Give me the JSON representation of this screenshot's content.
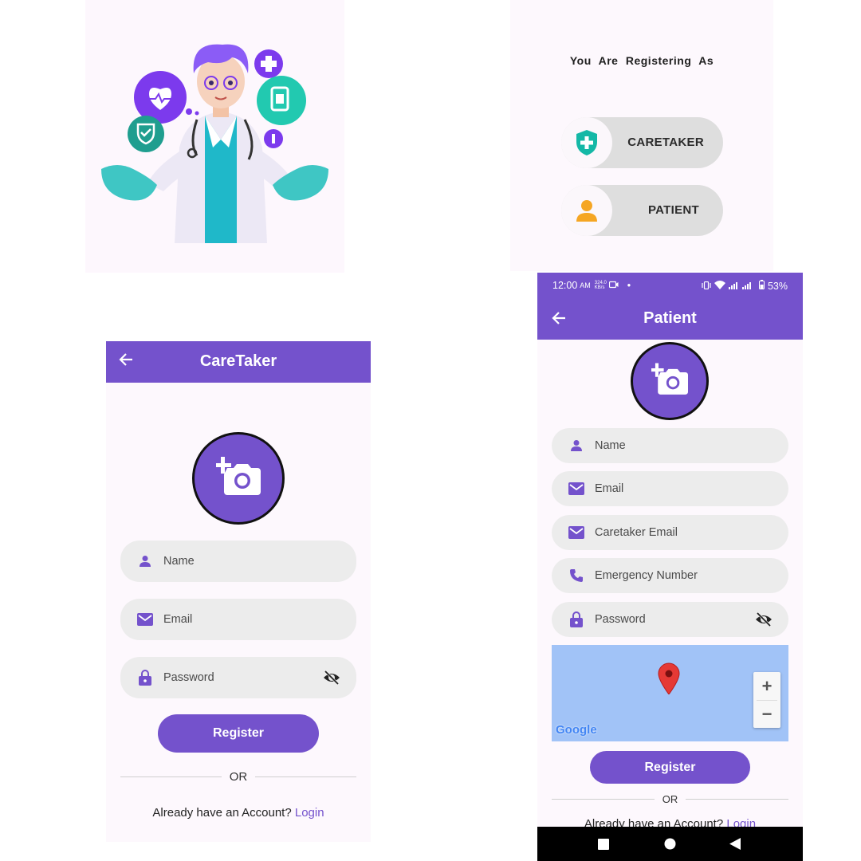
{
  "role_select": {
    "heading": "You  Are  Registering  As",
    "options": [
      {
        "label": "CARETAKER",
        "icon": "shield-plus-icon"
      },
      {
        "label": "PATIENT",
        "icon": "person-icon"
      }
    ]
  },
  "caretaker_screen": {
    "title": "CareTaker",
    "fields": {
      "name": "Name",
      "email": "Email",
      "password": "Password"
    },
    "register_label": "Register",
    "or_label": "OR",
    "login_prompt": "Already have an Account?",
    "login_link": "Login"
  },
  "patient_screen": {
    "status_bar": {
      "time": "12:00",
      "ampm": "AM",
      "speed_top": "324.0",
      "speed_bottom": "KB/s",
      "battery": "53%"
    },
    "title": "Patient",
    "fields": {
      "name": "Name",
      "email": "Email",
      "caretaker_email": "Caretaker Email",
      "emergency_number": "Emergency Number",
      "password": "Password"
    },
    "map_logo": "Google",
    "zoom_in": "+",
    "zoom_out": "−",
    "register_label": "Register",
    "or_label": "OR",
    "login_prompt": "Already have an Account?",
    "login_link": "Login"
  },
  "colors": {
    "primary": "#7452cc",
    "field_bg": "#ececec",
    "screen_bg": "#fdf8fd",
    "map_bg": "#a1c3f7",
    "shield_teal": "#14b8a6",
    "person_orange": "#f5a623"
  }
}
